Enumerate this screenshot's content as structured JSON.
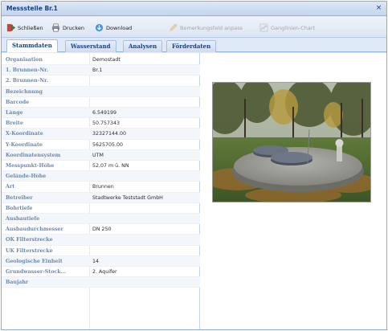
{
  "window": {
    "title": "Messstelle Br.1",
    "close_glyph": "×"
  },
  "toolbar": {
    "close_label": "Schließen",
    "print_label": "Drucken",
    "download_label": "Download",
    "remark_label": "Bemerkungsfeld anpass",
    "hydrograph_label": "Ganglinien-Chart"
  },
  "tabs": [
    "Stammdaten",
    "Wasserstand",
    "Analysen",
    "Förderdaten"
  ],
  "active_tab": "Stammdaten",
  "fields": [
    {
      "key": "Organisation",
      "value": "Demostadt"
    },
    {
      "key": "1. Brunnen-Nr.",
      "value": "Br.1"
    },
    {
      "key": "2. Brunnen-Nr.",
      "value": ""
    },
    {
      "key": "Bezeichnung",
      "value": ""
    },
    {
      "key": "Barcode",
      "value": ""
    },
    {
      "key": "Länge",
      "value": "6.549199"
    },
    {
      "key": "Breite",
      "value": "50.757343"
    },
    {
      "key": "X-Koordinate",
      "value": "32327144.00"
    },
    {
      "key": "Y-Koordinate",
      "value": "5625705.00"
    },
    {
      "key": "Koordinatensystem",
      "value": "UTM"
    },
    {
      "key": "Messpunkt-Höhe",
      "value": "52,07 m ü. NN"
    },
    {
      "key": "Gelände-Höhe",
      "value": ""
    },
    {
      "key": "Art",
      "value": "Brunnen"
    },
    {
      "key": "Betreiber",
      "value": "Stadtwerke Teststadt GmbH"
    },
    {
      "key": "Bohrtiefe",
      "value": ""
    },
    {
      "key": "Ausbautiefe",
      "value": ""
    },
    {
      "key": "Ausbaudurchmesser",
      "value": "DN 250"
    },
    {
      "key": "OK Filterstrecke",
      "value": ""
    },
    {
      "key": "UK Filterstrecke",
      "value": ""
    },
    {
      "key": "Geologische Einheit",
      "value": "14"
    },
    {
      "key": "Grundwasser-Stock...",
      "value": "2. Aquifer"
    },
    {
      "key": "Baujahr",
      "value": ""
    }
  ],
  "icons": {
    "close": "exit-door-icon",
    "print": "printer-icon",
    "download": "download-icon",
    "remark": "pencil-icon",
    "hydrograph": "chart-icon"
  },
  "colors": {
    "title": "#15428b",
    "label": "#6e87ad",
    "accent": "#8db2e3"
  }
}
